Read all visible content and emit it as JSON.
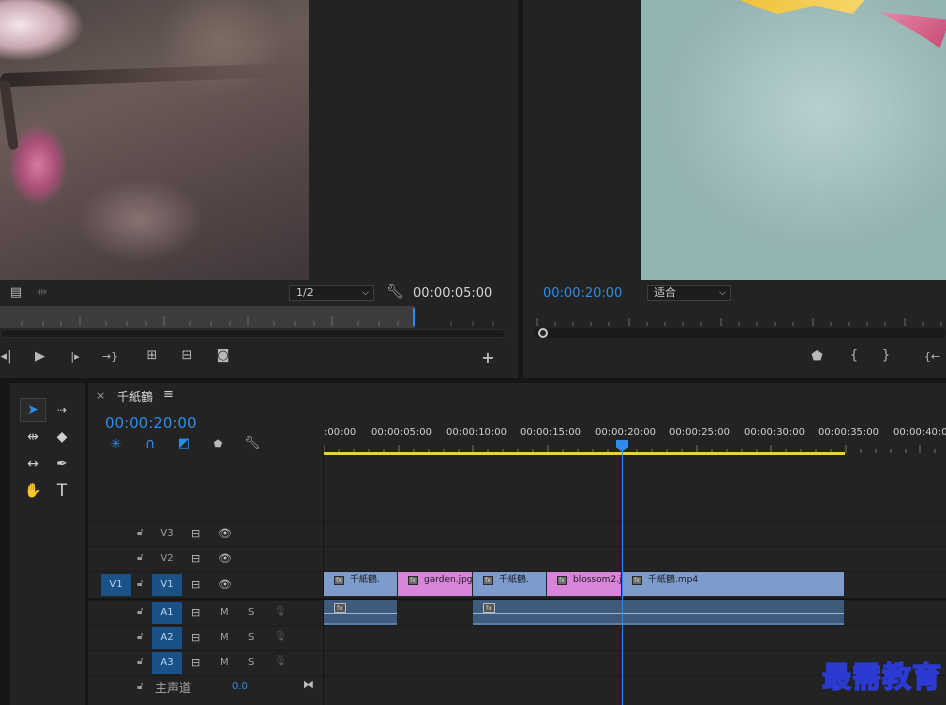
{
  "source_monitor": {
    "resolution": "1/2",
    "timecode": "00:00:05:00"
  },
  "program_monitor": {
    "timecode": "00:00:20:00",
    "fit": "适合"
  },
  "timeline": {
    "sequence_name": "千紙鶴",
    "timecode": "00:00:20:00",
    "ruler_labels": [
      ":00:00",
      "00:00:05:00",
      "00:00:10:00",
      "00:00:15:00",
      "00:00:20:00",
      "00:00:25:00",
      "00:00:30:00",
      "00:00:35:00",
      "00:00:40:00"
    ],
    "video_tracks": [
      {
        "name": "V3"
      },
      {
        "name": "V2"
      },
      {
        "name": "V1",
        "source": "V1"
      }
    ],
    "audio_tracks": [
      {
        "name": "A1",
        "m": "M",
        "s": "S"
      },
      {
        "name": "A2",
        "m": "M",
        "s": "S"
      },
      {
        "name": "A3",
        "m": "M",
        "s": "S"
      }
    ],
    "master": {
      "label": "主声道",
      "value": "0.0"
    },
    "v1_clips": [
      "千紙鶴.",
      "garden.jpg",
      "千紙鶴.",
      "blossom2.j",
      "千紙鶴.mp4"
    ]
  },
  "watermark": "最需教育",
  "colors": {
    "accent": "#2d8ceb",
    "clip_video": "#7d9ccc",
    "clip_image": "#d784d9",
    "audio_clip": "#3e5a7d"
  }
}
